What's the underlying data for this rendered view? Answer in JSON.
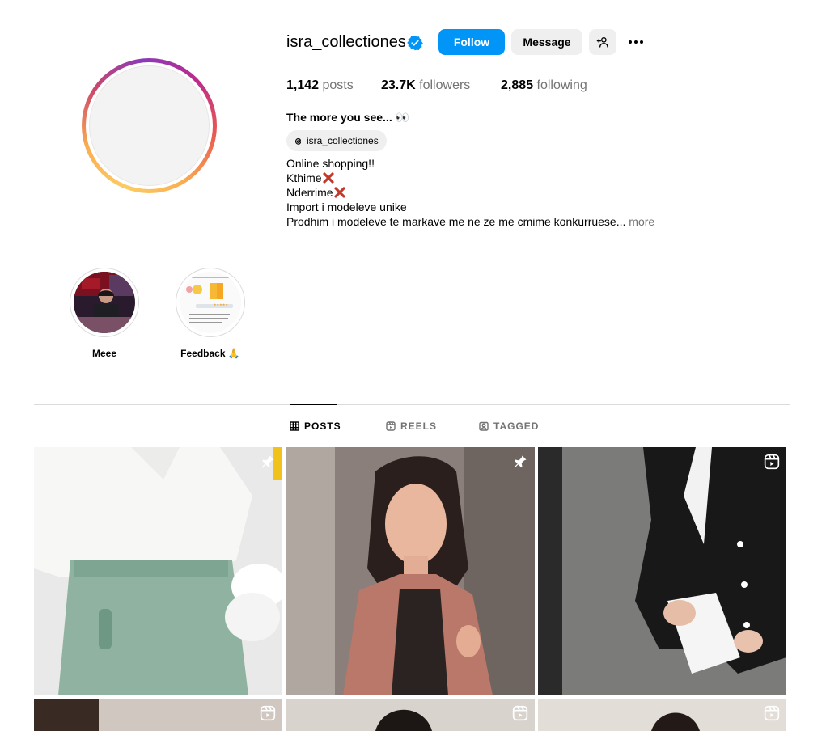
{
  "profile": {
    "username": "isra_collectiones",
    "verified": true,
    "follow_label": "Follow",
    "message_label": "Message",
    "add_user_icon": "person-plus-icon",
    "options_icon": "more-horizontal-icon"
  },
  "stats": {
    "posts_count": "1,142",
    "posts_label": "posts",
    "followers_count": "23.7K",
    "followers_label": "followers",
    "following_count": "2,885",
    "following_label": "following"
  },
  "bio": {
    "name": "The more you see... 👀",
    "threads_handle": "isra_collectiones",
    "lines": [
      "Online shopping!!",
      "Kthime",
      "Nderrime",
      "Import i modeleve unike",
      "Prodhim i modeleve te markave me ne ze me cmime konkurruese..."
    ],
    "more_label": "more"
  },
  "highlights": [
    {
      "label": "Meee"
    },
    {
      "label": "Feedback 🙏"
    }
  ],
  "tabs": [
    {
      "label": "POSTS",
      "icon": "grid-icon",
      "active": true
    },
    {
      "label": "REELS",
      "icon": "reels-icon",
      "active": false
    },
    {
      "label": "TAGGED",
      "icon": "tagged-icon",
      "active": false
    }
  ],
  "posts": [
    {
      "type": "pinned",
      "icon": "pin-icon"
    },
    {
      "type": "pinned",
      "icon": "pin-icon"
    },
    {
      "type": "reel",
      "icon": "reel-icon"
    },
    {
      "type": "reel",
      "icon": "reel-icon"
    },
    {
      "type": "reel",
      "icon": "reel-icon"
    },
    {
      "type": "reel",
      "icon": "reel-icon"
    }
  ],
  "colors": {
    "follow_blue": "#0095f6",
    "secondary_button": "#efefef",
    "muted_text": "#737373",
    "divider": "#dbdbdb",
    "verified_blue": "#0095f6"
  }
}
